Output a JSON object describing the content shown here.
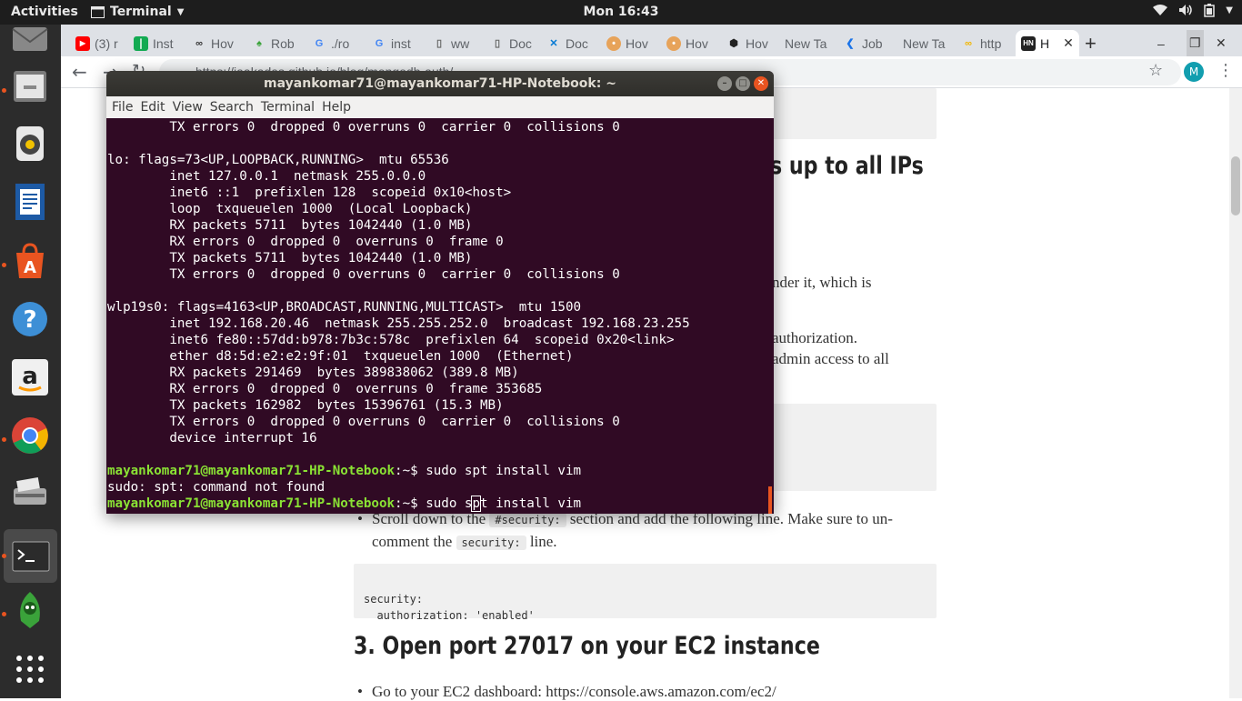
{
  "topbar": {
    "activities": "Activities",
    "app": "Terminal",
    "clock": "Mon 16:43"
  },
  "dock": [
    "email-icon",
    "files-icon",
    "rhythmbox-icon",
    "writer-icon",
    "software-icon",
    "help-icon",
    "amazon-icon",
    "chrome-icon",
    "scanner-icon",
    "terminal-icon",
    "robo3t-icon",
    "apps-grid-icon"
  ],
  "tabs": [
    {
      "label": "(3) r",
      "fav": "youtube"
    },
    {
      "label": "Inst",
      "fav": "mongodb"
    },
    {
      "label": "Hov",
      "fav": "hackerrank"
    },
    {
      "label": "Rob",
      "fav": "robo"
    },
    {
      "label": "./ro",
      "fav": "google"
    },
    {
      "label": "inst",
      "fav": "google"
    },
    {
      "label": "ww",
      "fav": "doc"
    },
    {
      "label": "Doc",
      "fav": "doc"
    },
    {
      "label": "Doc",
      "fav": "vscode"
    },
    {
      "label": "Hov",
      "fav": "avatar"
    },
    {
      "label": "Hov",
      "fav": "avatar"
    },
    {
      "label": "Hov",
      "fav": "hex"
    },
    {
      "label": "New Ta",
      "fav": ""
    },
    {
      "label": "Job",
      "fav": "k"
    },
    {
      "label": "New Ta",
      "fav": ""
    },
    {
      "label": "http",
      "fav": "cc"
    },
    {
      "label": "H",
      "fav": "hn"
    }
  ],
  "omnibox": "https://jaakadas.github.io/blog/mongodb-auth/",
  "profile_initial": "M",
  "terminal": {
    "title": "mayankomar71@mayankomar71-HP-Notebook: ~",
    "menu": [
      "File",
      "Edit",
      "View",
      "Search",
      "Terminal",
      "Help"
    ],
    "lines": [
      "        TX errors 0  dropped 0 overruns 0  carrier 0  collisions 0",
      "",
      "lo: flags=73<UP,LOOPBACK,RUNNING>  mtu 65536",
      "        inet 127.0.0.1  netmask 255.0.0.0",
      "        inet6 ::1  prefixlen 128  scopeid 0x10<host>",
      "        loop  txqueuelen 1000  (Local Loopback)",
      "        RX packets 5711  bytes 1042440 (1.0 MB)",
      "        RX errors 0  dropped 0  overruns 0  frame 0",
      "        TX packets 5711  bytes 1042440 (1.0 MB)",
      "        TX errors 0  dropped 0 overruns 0  carrier 0  collisions 0",
      "",
      "wlp19s0: flags=4163<UP,BROADCAST,RUNNING,MULTICAST>  mtu 1500",
      "        inet 192.168.20.46  netmask 255.255.252.0  broadcast 192.168.23.255",
      "        inet6 fe80::57dd:b978:7b3c:578c  prefixlen 64  scopeid 0x20<link>",
      "        ether d8:5d:e2:e2:9f:01  txqueuelen 1000  (Ethernet)",
      "        RX packets 291469  bytes 389838062 (389.8 MB)",
      "        RX errors 0  dropped 0  overruns 0  frame 353685",
      "        TX packets 162982  bytes 15396761 (15.3 MB)",
      "        TX errors 0  dropped 0 overruns 0  carrier 0  collisions 0",
      "        device interrupt 16",
      ""
    ],
    "prompt": "mayankomar71@mayankomar71-HP-Notebook",
    "prompt_suffix": ":~$ ",
    "cmd1": "sudo spt install vim",
    "error": "sudo: spt: command not found",
    "cmd2_a": "sudo s",
    "cmd2_cursor": "p",
    "cmd2_b": "t install vim"
  },
  "page": {
    "heading1_tail": "s up to all IPs",
    "text_a": "nder it, which is",
    "text_b": "authorization.",
    "text_c": "admin access to all",
    "bullet1_a": "Scroll down to the",
    "bullet1_code": "#security:",
    "bullet1_b": "section and add the following line. Make sure to un-",
    "bullet1_c": "comment the",
    "bullet1_code2": "security:",
    "bullet1_d": "line.",
    "code_line1": "security:",
    "code_line2": "  authorization: 'enabled'",
    "heading2": "3. Open port 27017 on your EC2 instance",
    "bullet2": "Go to your EC2 dashboard: https://console.aws.amazon.com/ec2/"
  },
  "colors": {
    "terminal_bg": "#300a24",
    "prompt": "#8ae234",
    "ubuntu_orange": "#e95420"
  }
}
